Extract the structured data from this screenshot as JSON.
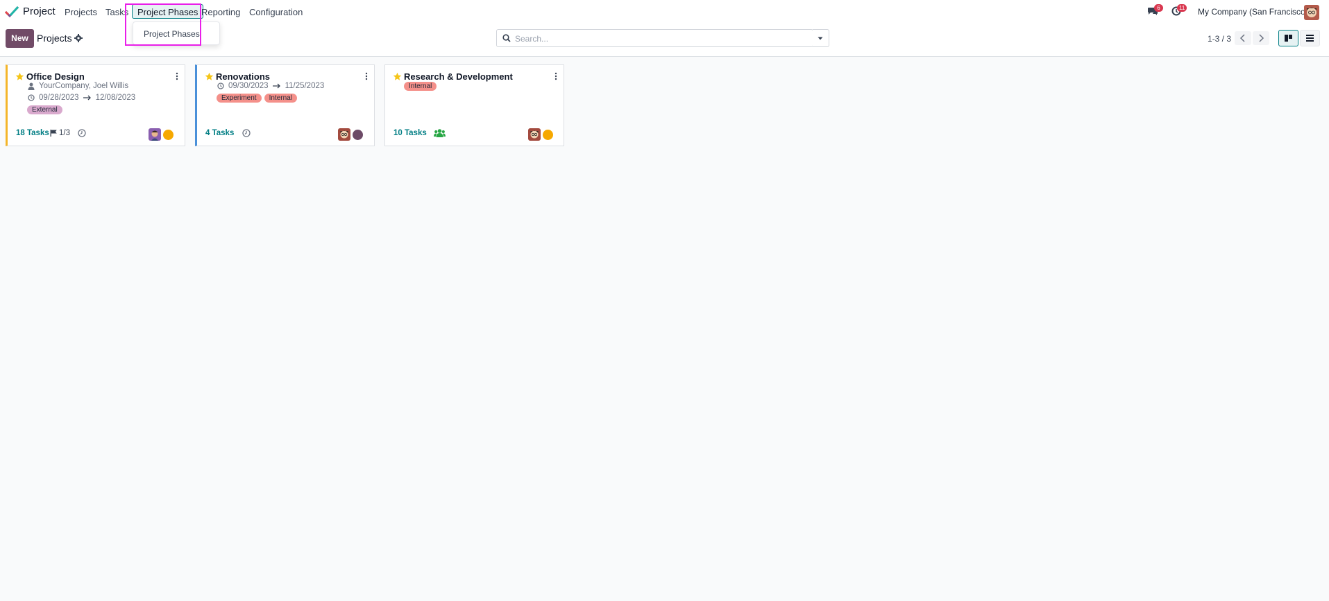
{
  "navbar": {
    "app_name": "Project",
    "menu": [
      "Projects",
      "Tasks",
      "Project Phases",
      "Reporting",
      "Configuration"
    ],
    "active_menu": "Project Phases",
    "dropdown_items": [
      "Project Phases"
    ],
    "messages_badge": "6",
    "activities_badge": "11",
    "company": "My Company (San Francisco)"
  },
  "control_panel": {
    "new_label": "New",
    "title": "Projects",
    "search_placeholder": "Search...",
    "pager": "1-3 / 3"
  },
  "cards": [
    {
      "title": "Office Design",
      "favorite": true,
      "customer": "YourCompany, Joel Willis",
      "date_start": "09/28/2023",
      "date_end": "12/08/2023",
      "tags": [
        "External"
      ],
      "tasks": "18 Tasks",
      "milestone": "1/3",
      "status_color": "#f6a800",
      "stripe_color": "#f4b529"
    },
    {
      "title": "Renovations",
      "favorite": true,
      "date_start": "09/30/2023",
      "date_end": "11/25/2023",
      "tags": [
        "Experiment",
        "Internal"
      ],
      "tasks": "4 Tasks",
      "status_color": "#6d4b67",
      "stripe_color": "#4a90d9"
    },
    {
      "title": "Research & Development",
      "favorite": true,
      "tags": [
        "Internal"
      ],
      "tasks": "10 Tasks",
      "status_color": "#f6a800"
    }
  ],
  "colors": {
    "brand": "#714b67",
    "accent": "#017e84",
    "badge": "#d9374f",
    "highlight": "#e91ee9"
  }
}
